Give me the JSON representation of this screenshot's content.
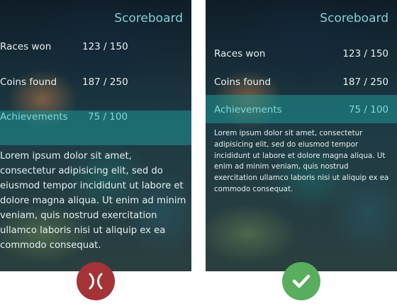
{
  "left": {
    "title": "Scoreboard",
    "stats": [
      {
        "label": "Races won",
        "value": "123 / 150"
      },
      {
        "label": "Coins found",
        "value": "187 / 250"
      },
      {
        "label": "Achievements",
        "value": "75 / 100"
      }
    ],
    "body": "Lorem ipsum dolor sit amet, consectetur adipisicing elit, sed do eiusmod tempor incididunt ut labore et dolore magna aliqua. Ut enim ad minim veniam, quis nostrud exercitation ullamco laboris nisi ut aliquip ex ea commodo consequat."
  },
  "right": {
    "title": "Scoreboard",
    "stats": [
      {
        "label": "Races won",
        "value": "123 / 150"
      },
      {
        "label": "Coins found",
        "value": "187 / 250"
      },
      {
        "label": "Achievements",
        "value": "75 / 100"
      }
    ],
    "body": "Lorem ipsum dolor sit amet, consectetur adipisicing elit, sed do eiusmod tempor incididunt ut labore et dolore magna aliqua. Ut enim ad minim veniam, quis nostrud exercitation ullamco laboris nisi ut aliquip ex ea commodo consequat."
  },
  "badges": {
    "incorrect_icon": "cross-icon",
    "correct_icon": "checkmark-icon",
    "incorrect_color": "#a33337",
    "correct_color": "#59ae5d"
  }
}
